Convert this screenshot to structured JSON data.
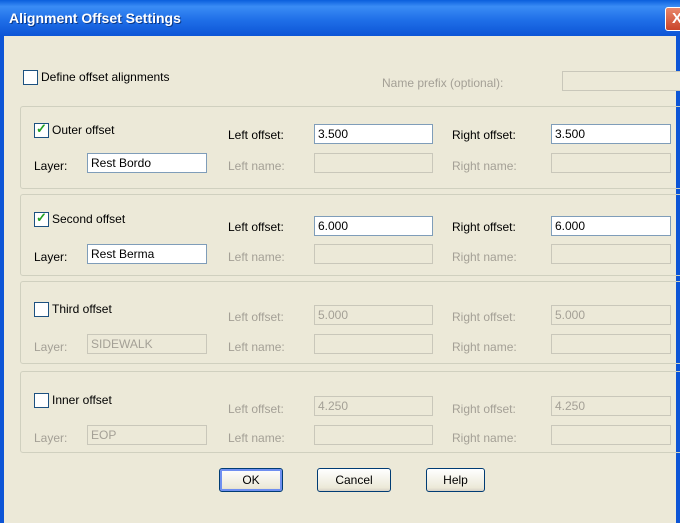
{
  "window": {
    "title": "Alignment Offset Settings",
    "close_glyph": "X"
  },
  "define": {
    "label": "Define offset alignments",
    "checked": false,
    "prefix_label": "Name prefix (optional):",
    "prefix_value": ""
  },
  "labels": {
    "layer": "Layer:",
    "left_offset": "Left offset:",
    "right_offset": "Right offset:",
    "left_name": "Left name:",
    "right_name": "Right name:"
  },
  "groups": [
    {
      "label": "Outer offset",
      "checked": true,
      "layer": "Rest Bordo",
      "left_offset": "3.500",
      "right_offset": "3.500",
      "left_name": "",
      "right_name": ""
    },
    {
      "label": "Second offset",
      "checked": true,
      "layer": "Rest Berma",
      "left_offset": "6.000",
      "right_offset": "6.000",
      "left_name": "",
      "right_name": ""
    },
    {
      "label": "Third offset",
      "checked": false,
      "layer": "SIDEWALK",
      "left_offset": "5.000",
      "right_offset": "5.000",
      "left_name": "",
      "right_name": ""
    },
    {
      "label": "Inner offset",
      "checked": false,
      "layer": "EOP",
      "left_offset": "4.250",
      "right_offset": "4.250",
      "left_name": "",
      "right_name": ""
    }
  ],
  "buttons": {
    "ok": "OK",
    "cancel": "Cancel",
    "help": "Help"
  },
  "colors": {
    "titlebar": "#0d55d6",
    "dialog_bg": "#ece9d8",
    "check_mark": "#21a121",
    "disabled_text": "#a4a096"
  }
}
